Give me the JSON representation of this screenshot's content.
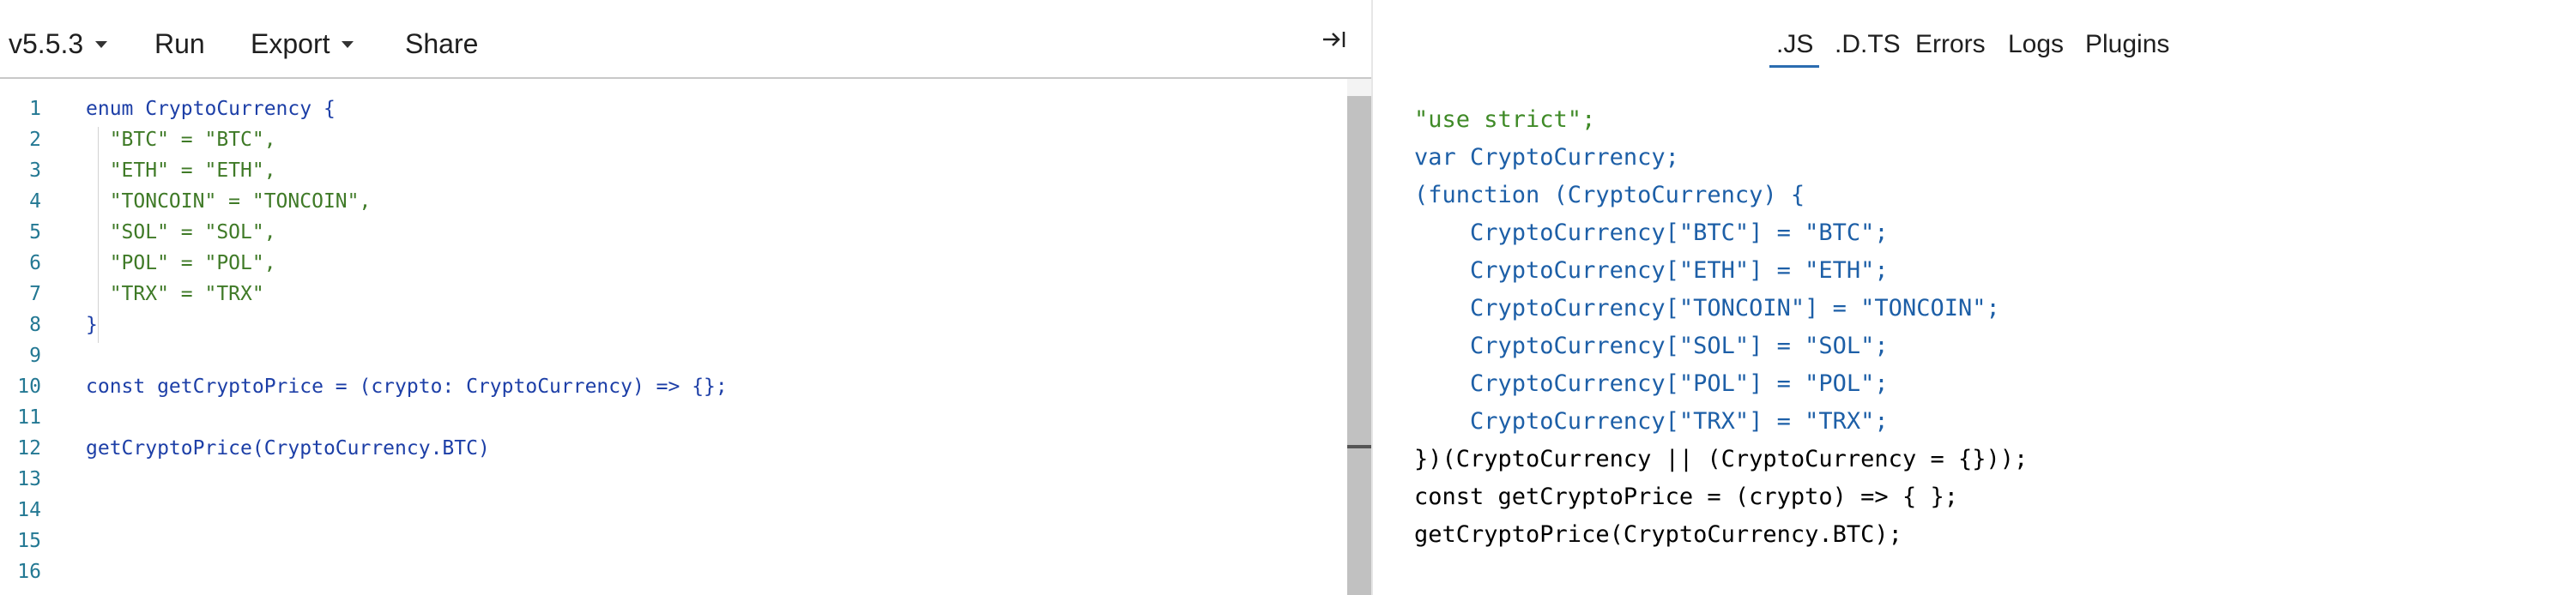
{
  "toolbar": {
    "version_label": "v5.5.3",
    "run_label": "Run",
    "export_label": "Export",
    "share_label": "Share",
    "collapse_icon": "collapse-right-icon"
  },
  "editor": {
    "line_numbers": [
      "1",
      "2",
      "3",
      "4",
      "5",
      "6",
      "7",
      "8",
      "9",
      "10",
      "11",
      "12",
      "13",
      "14",
      "15",
      "16"
    ],
    "lines": [
      "enum CryptoCurrency {",
      "  \"BTC\" = \"BTC\",",
      "  \"ETH\" = \"ETH\",",
      "  \"TONCOIN\" = \"TONCOIN\",",
      "  \"SOL\" = \"SOL\",",
      "  \"POL\" = \"POL\",",
      "  \"TRX\" = \"TRX\"",
      "}",
      "",
      "const getCryptoPrice = (crypto: CryptoCurrency) => {};",
      "",
      "getCryptoPrice(CryptoCurrency.BTC)",
      "",
      "",
      "",
      ""
    ]
  },
  "output": {
    "tabs": [
      ".JS",
      ".D.TS",
      "Errors",
      "Logs",
      "Plugins"
    ],
    "active_tab": ".JS",
    "lines": [
      "\"use strict\";",
      "var CryptoCurrency;",
      "(function (CryptoCurrency) {",
      "    CryptoCurrency[\"BTC\"] = \"BTC\";",
      "    CryptoCurrency[\"ETH\"] = \"ETH\";",
      "    CryptoCurrency[\"TONCOIN\"] = \"TONCOIN\";",
      "    CryptoCurrency[\"SOL\"] = \"SOL\";",
      "    CryptoCurrency[\"POL\"] = \"POL\";",
      "    CryptoCurrency[\"TRX\"] = \"TRX\";",
      "})(CryptoCurrency || (CryptoCurrency = {}));",
      "const getCryptoPrice = (crypto) => { };",
      "getCryptoPrice(CryptoCurrency.BTC);"
    ]
  },
  "colors": {
    "accent_underline": "#2b6cb0",
    "line_number": "#237893",
    "string_left": "#a31515",
    "string_right": "#3f8a27",
    "keyword": "#0000ff"
  }
}
